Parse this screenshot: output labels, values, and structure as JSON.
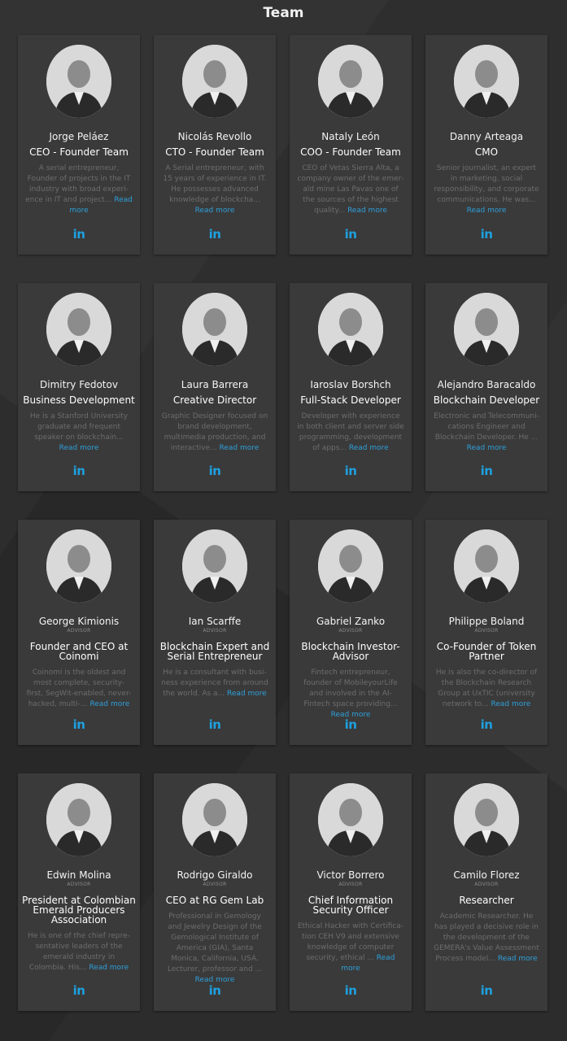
{
  "page": {
    "title": "Team"
  },
  "members": [
    {
      "name": "Jorge Peláez",
      "advisor": "",
      "role": "CEO - Founder Team",
      "bio": "A serial entrepreneur, Founder of projects in the IT industry with broad experi­ence in IT and project...",
      "more": "Read more"
    },
    {
      "name": "Nicolás Revollo",
      "advisor": "",
      "role": "CTO - Founder Team",
      "bio": "A Serial entrepreneur, with 15 years of experience in IT. He possesses advanced knowl­edge of blockcha...",
      "more": "Read more"
    },
    {
      "name": "Nataly León",
      "advisor": "",
      "role": "COO - Founder Team",
      "bio": "CEO of Vetas Sierra Alta, a company owner of the emer­ald mine Las Pavas one of the sources of the highest qual­ity...",
      "more": "Read more"
    },
    {
      "name": "Danny Arteaga",
      "advisor": "",
      "role": "CMO",
      "bio": "Senior journalist, an expert in marketing, social responsibil­ity, and corporate communi­cations. He was...",
      "more": "Read more"
    },
    {
      "name": "Dimitry Fedotov",
      "advisor": "",
      "role": "Business Development",
      "bio": "He is a Stanford University graduate and frequent speaker on blockchain...",
      "more": "Read more"
    },
    {
      "name": "Laura Barrera",
      "advisor": "",
      "role": "Creative Director",
      "bio": "Graphic Designer focused on brand development, multime­dia production, and interac­tive...",
      "more": "Read more"
    },
    {
      "name": "Iaroslav Borshch",
      "advisor": "",
      "role": "Full-Stack Developer",
      "bio": "Developer with experience in both client and server side programming, development of apps...",
      "more": "Read more"
    },
    {
      "name": "Alejandro Baracaldo",
      "advisor": "",
      "role": "Blockchain Developer",
      "bio": "Electronic and Telecommuni­cations Engineer and Blockchain Developer. He ...",
      "more": "Read more"
    },
    {
      "name": "George Kimionis",
      "advisor": "ADVISOR",
      "role": "Founder and CEO at Coinomi",
      "bio": "Coinomi is the oldest and most complete, security-first, SegWit-enabled, never-hacked, multi-...",
      "more": "Read more"
    },
    {
      "name": "Ian Scarffe",
      "advisor": "ADVISOR",
      "role": "Blockchain Expert and Serial Entrepreneur",
      "bio": "He is a consultant with busi­ness experience from around the world. As a...",
      "more": "Read more"
    },
    {
      "name": "Gabriel Zanko",
      "advisor": "ADVISOR",
      "role": "Blockchain Investor-Advisor",
      "bio": "Fintech entrepreneur, founder of MobileyourLife and involved in the AI-Fintech space providing...",
      "more": "Read more"
    },
    {
      "name": "Philippe Boland",
      "advisor": "ADVISOR",
      "role": "Co-Founder of Token Partner",
      "bio": "He is also the co-director of the Blockchain Research Group at UxTIC (university network to...",
      "more": "Read more"
    },
    {
      "name": "Edwin Molina",
      "advisor": "ADVISOR",
      "role": "President at Colombian Emerald Producers Association",
      "bio": "He is one of the chief repre­sentative leaders of the emer­ald industry in Colombia. His...",
      "more": "Read more"
    },
    {
      "name": "Rodrigo Giraldo",
      "advisor": "ADVISOR",
      "role": "CEO at RG Gem Lab",
      "bio": "Professional in Gemology and Jewelry Design of the Gemo­logical Institute of America (GIA), Santa Monica, Califor­nia, USA. Lecturer, professor and ...",
      "more": "Read more"
    },
    {
      "name": "Victor Borrero",
      "advisor": "ADVISOR",
      "role": "Chief Information Security Officer",
      "bio": "Ethical Hacker with Certifica­tion CEH V9 and extensive knowledge of computer secu­rity, ethical ...",
      "more": "Read more"
    },
    {
      "name": "Camilo Florez",
      "advisor": "ADVISOR",
      "role": "Researcher",
      "bio": "Academic Researcher. He has played a decisive role in the development of the GEMERA's Value Assess­ment Process model...",
      "more": "Read more"
    }
  ],
  "linkedin_label": "in",
  "colors": {
    "background": "#2b2b2b",
    "card": "#3a3a3a",
    "accent": "#2e9fd9",
    "linkedin": "#1ea0df"
  }
}
